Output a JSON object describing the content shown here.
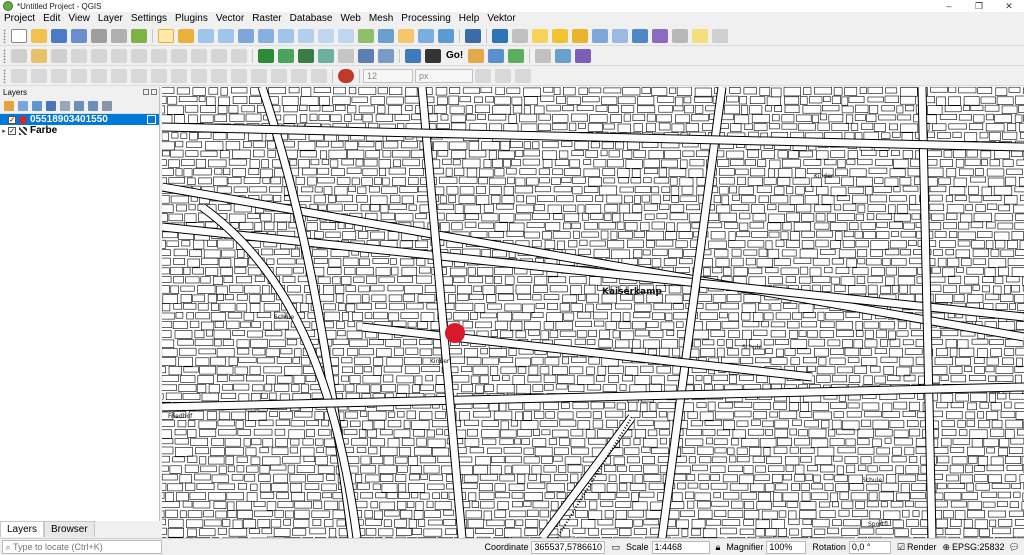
{
  "window": {
    "title": "*Untitled Project - QGIS",
    "minimize": "–",
    "maximize": "❐",
    "close": "✕"
  },
  "menu": [
    "Project",
    "Edit",
    "View",
    "Layer",
    "Settings",
    "Plugins",
    "Vector",
    "Raster",
    "Database",
    "Web",
    "Mesh",
    "Processing",
    "Help",
    "Vektor"
  ],
  "toolbar": {
    "go_label": "Go!",
    "symbol_size": "12",
    "unit": "px"
  },
  "layers_panel": {
    "title": "Layers",
    "layers": [
      {
        "name": "05518903401550",
        "checked": "✓",
        "selected": true,
        "symbol_color": "#d62728"
      },
      {
        "name": "Farbe",
        "checked": "✓",
        "selected": false
      }
    ]
  },
  "panel_tabs": [
    "Layers",
    "Browser"
  ],
  "map": {
    "labels": [
      "Kaiserkamp",
      "Schule",
      "Friedhof",
      "Schule",
      "Kinder",
      "Kinder",
      "Schule",
      "Sportfl"
    ],
    "marker_color": "#d7192a"
  },
  "status": {
    "locator_placeholder": "Type to locate (Ctrl+K)",
    "coordinate_label": "Coordinate",
    "coordinate": "365537,5786610",
    "scale_label": "Scale",
    "scale": "1:4468",
    "magnifier_label": "Magnifier",
    "magnifier": "100%",
    "rotation_label": "Rotation",
    "rotation": "0,0 °",
    "render_label": "Render",
    "crs": "EPSG:25832"
  }
}
